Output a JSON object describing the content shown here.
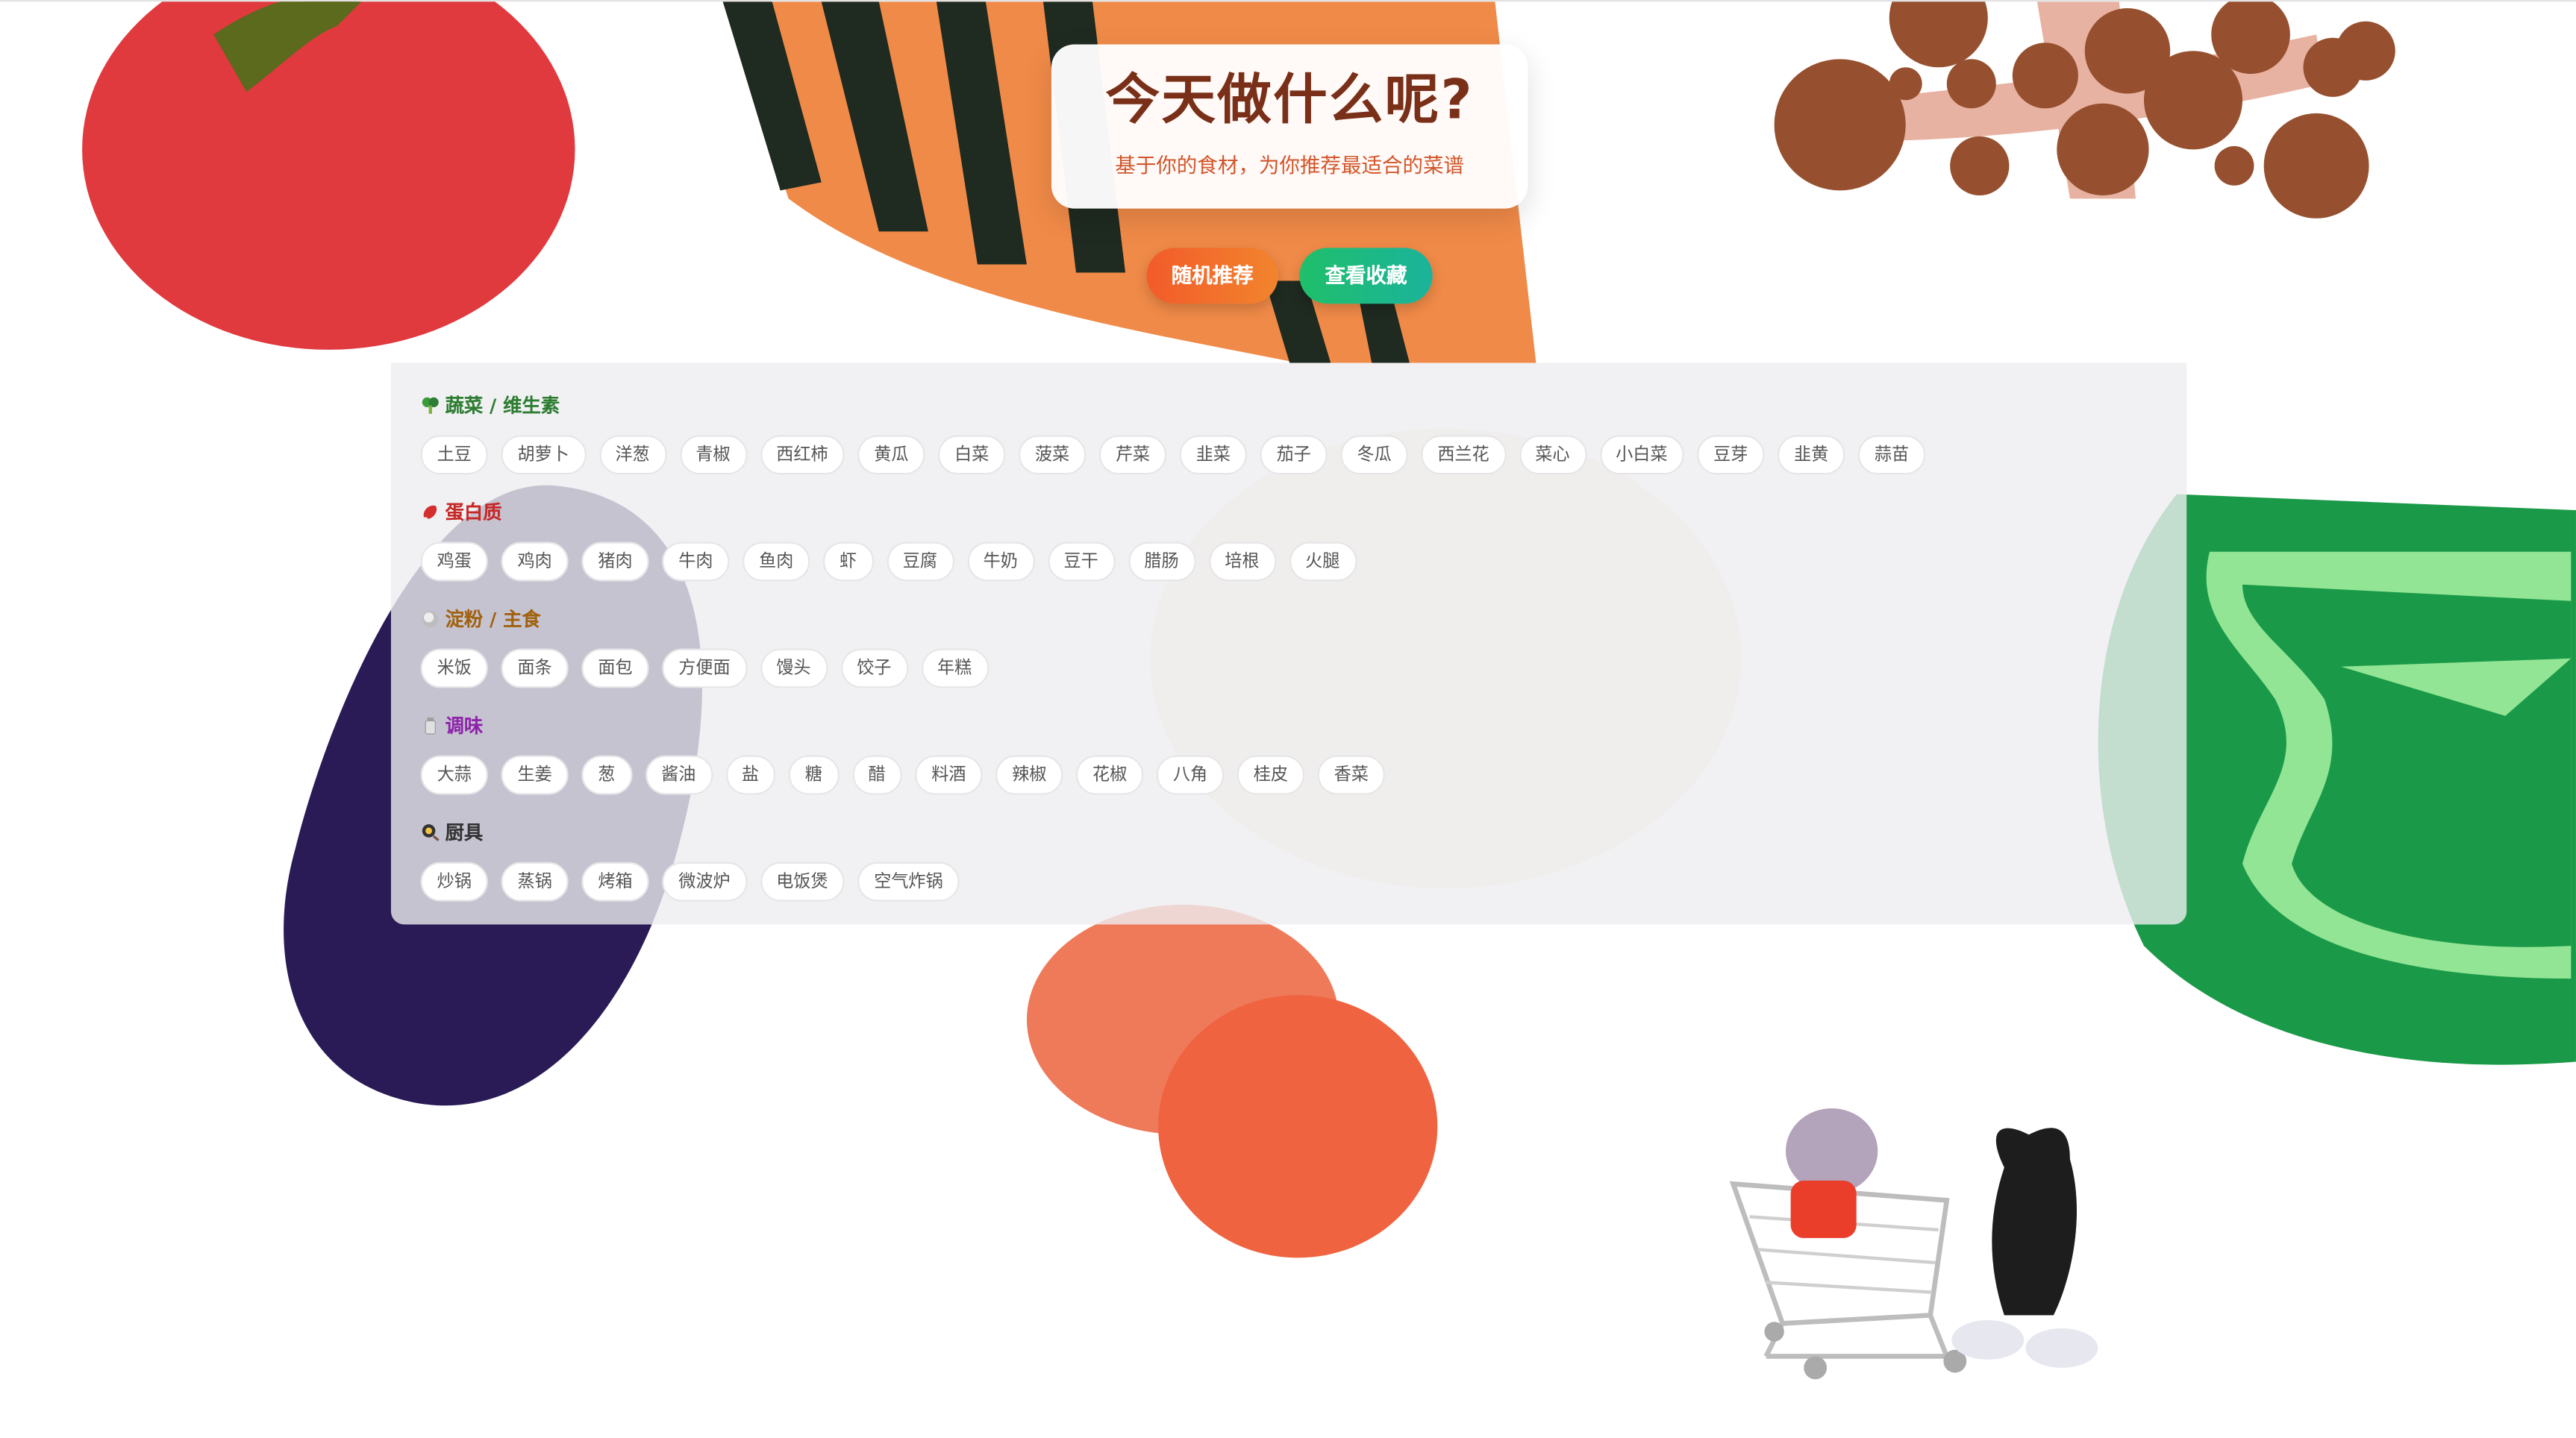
{
  "header": {
    "title": "今天做什么呢?",
    "subtitle": "基于你的食材，为你推荐最适合的菜谱"
  },
  "actions": {
    "random_label": "随机推荐",
    "favorites_label": "查看收藏"
  },
  "colors": {
    "title": "#7a3018",
    "subtitle": "#d2562a",
    "random_button": "#f26b2c",
    "favorites_button": "#1ebb7e",
    "vegetables": "#2e7d32",
    "protein": "#c62828",
    "staples": "#a0620f",
    "seasoning": "#8e24aa",
    "tools": "#333333"
  },
  "categories": [
    {
      "label": "蔬菜 / 维生素",
      "icon": "broccoli-icon",
      "items": [
        "土豆",
        "胡萝卜",
        "洋葱",
        "青椒",
        "西红柿",
        "黄瓜",
        "白菜",
        "菠菜",
        "芹菜",
        "韭菜",
        "茄子",
        "冬瓜",
        "西兰花",
        "菜心",
        "小白菜",
        "豆芽",
        "韭黄",
        "蒜苗"
      ]
    },
    {
      "label": "蛋白质",
      "icon": "meat-icon",
      "items": [
        "鸡蛋",
        "鸡肉",
        "猪肉",
        "牛肉",
        "鱼肉",
        "虾",
        "豆腐",
        "牛奶",
        "豆干",
        "腊肠",
        "培根",
        "火腿"
      ]
    },
    {
      "label": "淀粉 / 主食",
      "icon": "rice-icon",
      "items": [
        "米饭",
        "面条",
        "面包",
        "方便面",
        "馒头",
        "饺子",
        "年糕"
      ]
    },
    {
      "label": "调味",
      "icon": "salt-shaker-icon",
      "items": [
        "大蒜",
        "生姜",
        "葱",
        "酱油",
        "盐",
        "糖",
        "醋",
        "料酒",
        "辣椒",
        "花椒",
        "八角",
        "桂皮",
        "香菜"
      ]
    },
    {
      "label": "厨具",
      "icon": "frying-pan-icon",
      "items": [
        "炒锅",
        "蒸锅",
        "烤箱",
        "微波炉",
        "电饭煲",
        "空气炸锅"
      ]
    }
  ]
}
